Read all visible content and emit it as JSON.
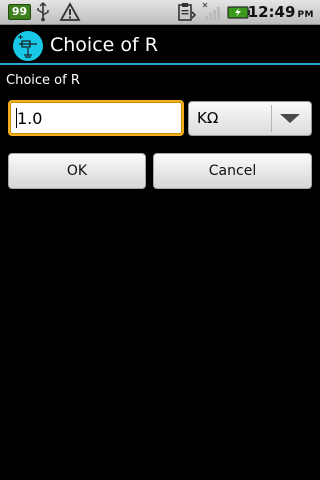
{
  "status_bar": {
    "notification_badge": "99",
    "time": "12:49",
    "ampm": "PM",
    "icons": [
      "usb-icon",
      "warning-icon",
      "clipboard-icon",
      "no-signal-icon",
      "battery-charging-icon"
    ]
  },
  "title_bar": {
    "app_icon": "circuit-icon",
    "title": "Choice of R",
    "accent_color": "#2aa3d6"
  },
  "dialog": {
    "label": "Choice of R",
    "value_input": "1.0",
    "unit_selected": "KΩ",
    "ok_label": "OK",
    "cancel_label": "Cancel",
    "focus_color": "#f2b01e"
  }
}
